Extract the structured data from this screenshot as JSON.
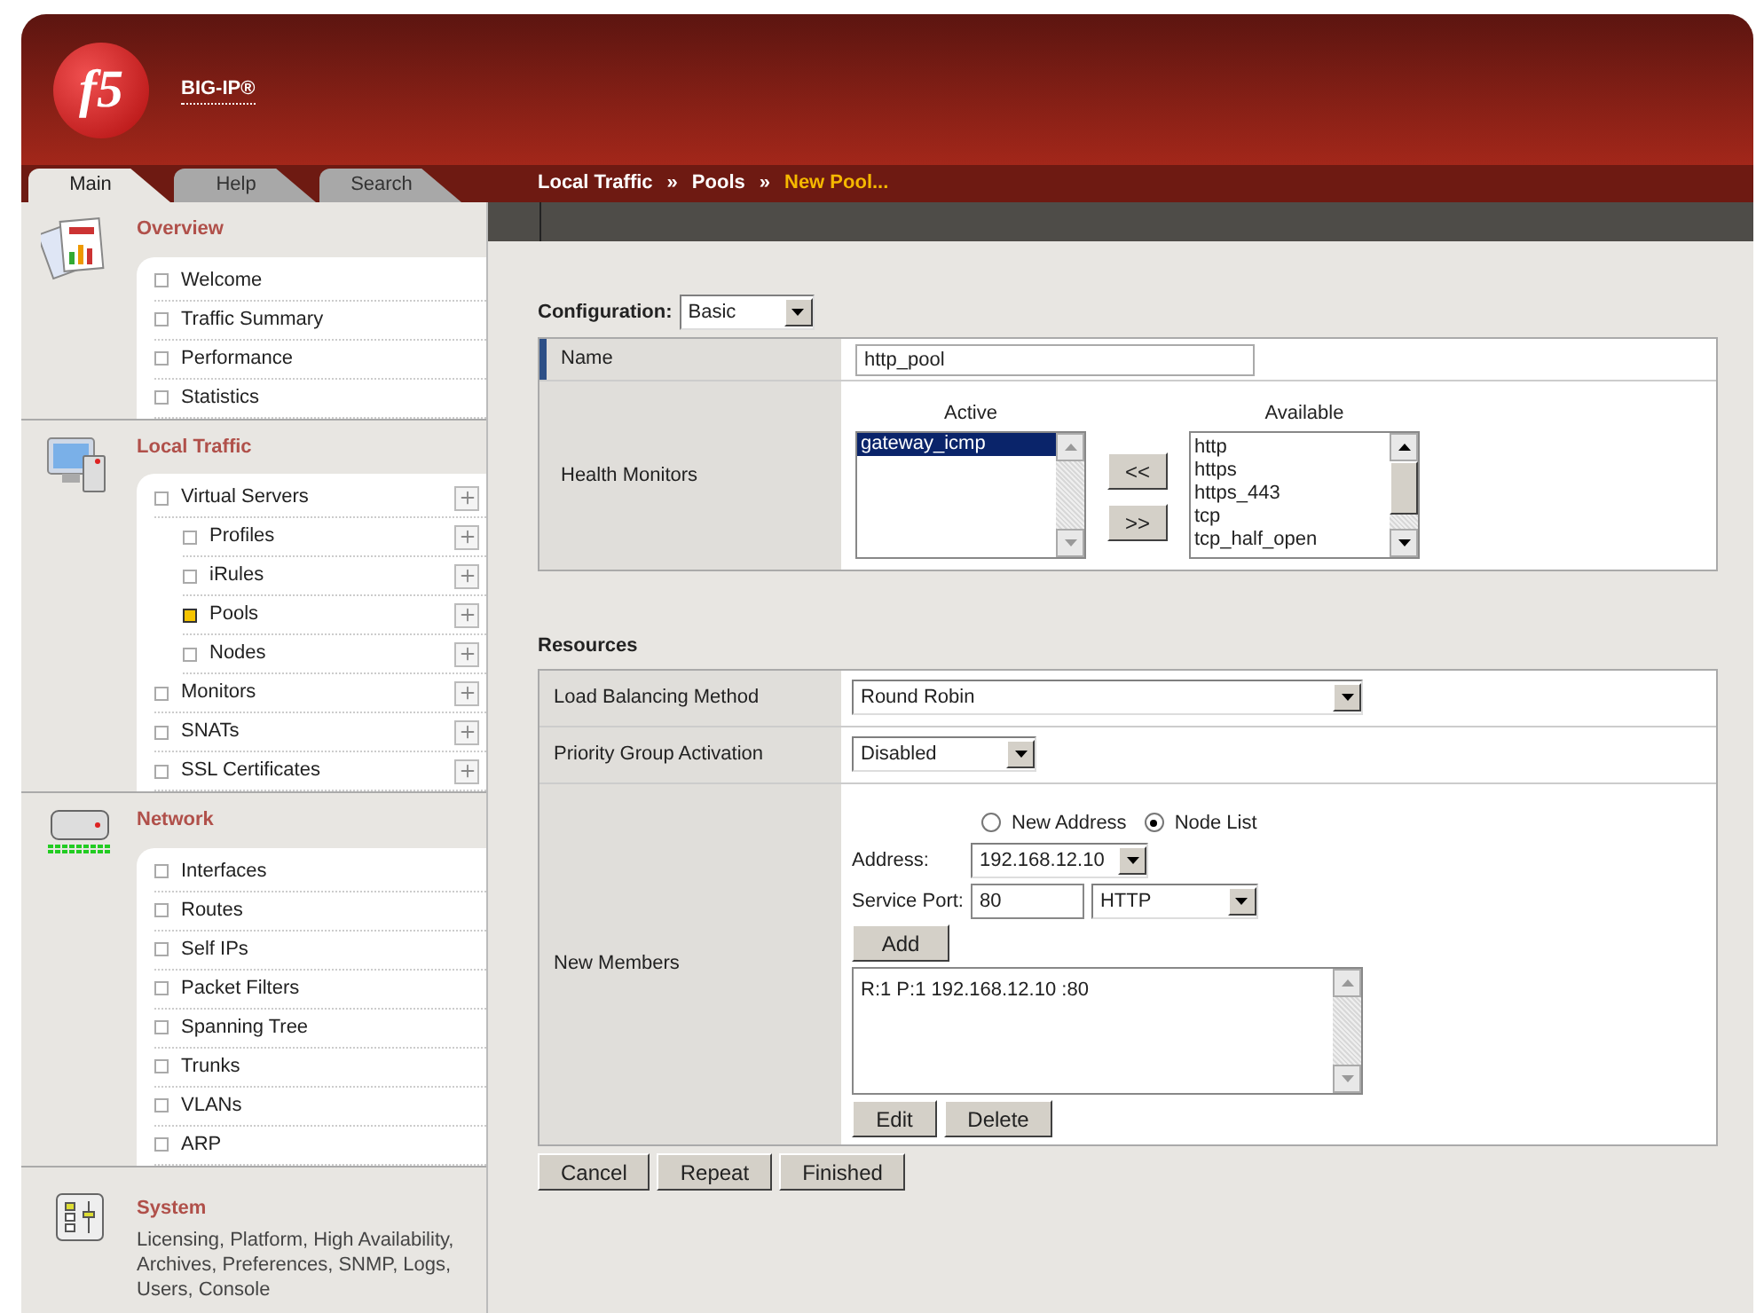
{
  "header": {
    "logo_text": "f5",
    "product": "BIG-IP®"
  },
  "tabs": [
    {
      "label": "Main",
      "selected": true
    },
    {
      "label": "Help",
      "selected": false
    },
    {
      "label": "Search",
      "selected": false
    }
  ],
  "breadcrumb": [
    {
      "kind": "link",
      "label": "Local Traffic"
    },
    {
      "kind": "separator",
      "label": "»"
    },
    {
      "kind": "link",
      "label": "Pools"
    },
    {
      "kind": "separator",
      "label": "»"
    },
    {
      "kind": "current",
      "label": "New Pool..."
    }
  ],
  "sidebar": [
    {
      "kind": "overview",
      "title": "Overview",
      "items": [
        {
          "label": "Welcome",
          "selected": false,
          "add": false
        },
        {
          "label": "Traffic Summary",
          "selected": false,
          "add": false
        },
        {
          "label": "Performance",
          "selected": false,
          "add": false
        },
        {
          "label": "Statistics",
          "selected": false,
          "add": false
        }
      ]
    },
    {
      "kind": "local",
      "title": "Local Traffic",
      "items": [
        {
          "label": "Virtual Servers",
          "selected": false,
          "add": true,
          "children": [
            {
              "label": "Profiles",
              "selected": false,
              "add": true
            },
            {
              "label": "iRules",
              "selected": false,
              "add": true
            },
            {
              "label": "Pools",
              "selected": true,
              "add": true
            },
            {
              "label": "Nodes",
              "selected": false,
              "add": true
            }
          ]
        },
        {
          "label": "Monitors",
          "selected": false,
          "add": true
        },
        {
          "label": "SNATs",
          "selected": false,
          "add": true
        },
        {
          "label": "SSL Certificates",
          "selected": false,
          "add": true
        }
      ]
    },
    {
      "kind": "network",
      "title": "Network",
      "items": [
        {
          "label": "Interfaces",
          "selected": false,
          "add": false
        },
        {
          "label": "Routes",
          "selected": false,
          "add": false
        },
        {
          "label": "Self IPs",
          "selected": false,
          "add": false
        },
        {
          "label": "Packet Filters",
          "selected": false,
          "add": false
        },
        {
          "label": "Spanning Tree",
          "selected": false,
          "add": false
        },
        {
          "label": "Trunks",
          "selected": false,
          "add": false
        },
        {
          "label": "VLANs",
          "selected": false,
          "add": false
        },
        {
          "label": "ARP",
          "selected": false,
          "add": false
        }
      ]
    },
    {
      "kind": "system",
      "title": "System",
      "description": "Licensing, Platform, High Availability, Archives, Preferences, SNMP, Logs, Users, Console"
    }
  ],
  "configuration": {
    "label": "Configuration:",
    "value": "Basic"
  },
  "general": {
    "name": {
      "label": "Name",
      "value": "http_pool"
    },
    "health_monitors": {
      "label": "Health Monitors",
      "active_heading": "Active",
      "available_heading": "Available",
      "active": [
        {
          "label": "gateway_icmp",
          "selected": true
        }
      ],
      "available": [
        {
          "label": "http",
          "selected": false
        },
        {
          "label": "https",
          "selected": false
        },
        {
          "label": "https_443",
          "selected": false
        },
        {
          "label": "tcp",
          "selected": false
        },
        {
          "label": "tcp_half_open",
          "selected": false
        }
      ],
      "add_button": "<<",
      "remove_button": ">>"
    }
  },
  "resources": {
    "heading": "Resources",
    "load_balancing": {
      "label": "Load Balancing Method",
      "value": "Round Robin"
    },
    "priority_group": {
      "label": "Priority Group Activation",
      "value": "Disabled"
    },
    "new_members": {
      "label": "New Members",
      "options": [
        {
          "label": "New Address",
          "selected": false
        },
        {
          "label": "Node List",
          "selected": true
        }
      ],
      "address_label": "Address:",
      "address": "192.168.12.10",
      "port_label": "Service Port:",
      "port": "80",
      "service": "HTTP",
      "add_button": "Add",
      "members": [
        "R:1 P:1 192.168.12.10 :80"
      ],
      "edit_button": "Edit",
      "delete_button": "Delete"
    }
  },
  "actions": [
    "Cancel",
    "Repeat",
    "Finished"
  ]
}
